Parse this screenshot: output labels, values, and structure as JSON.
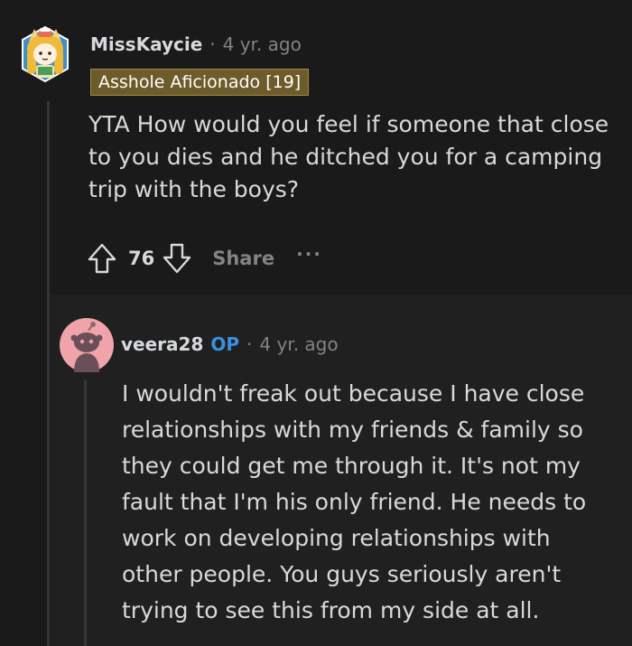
{
  "comment": {
    "username": "MissKaycie",
    "separator": "·",
    "time": "4 yr. ago",
    "flair": "Asshole Aficionado [19]",
    "body": "YTA How would you feel if someone that close to you dies and he ditched you for a camping trip with the boys?",
    "actions": {
      "upvote_icon": "upvote-arrow-icon",
      "score": "76",
      "downvote_icon": "downvote-arrow-icon",
      "share_label": "Share",
      "more_icon": "more-dots-icon",
      "more_label": "···"
    },
    "avatar_icon": "cat-avatar-icon"
  },
  "reply": {
    "username": "veera28",
    "op_badge": "OP",
    "separator": "·",
    "time": "4 yr. ago",
    "body": "I wouldn't freak out because I have close relationships with my friends & family so they could get me through it. It's not my fault that I'm his only friend. He needs to work on developing relationships with other people. You guys seriously aren't trying to see this from my side at all.",
    "avatar_icon": "snoo-avatar-icon"
  },
  "colors": {
    "background": "#1a1a1b",
    "reply_background": "#202021",
    "text": "#d7dadc",
    "muted": "#818384",
    "flair_bg": "#6e5b2a",
    "op_blue": "#3a8fe0"
  }
}
